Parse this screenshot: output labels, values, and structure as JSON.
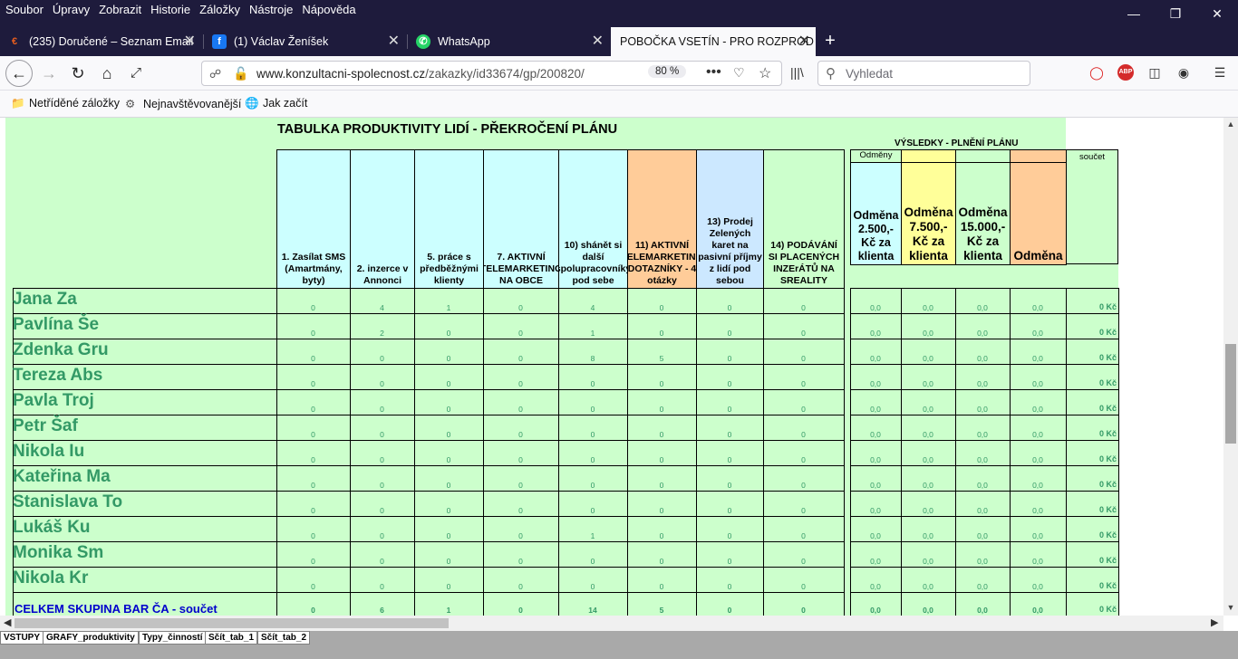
{
  "menu": [
    "Soubor",
    "Úpravy",
    "Zobrazit",
    "Historie",
    "Záložky",
    "Nástroje",
    "Nápověda"
  ],
  "tabs": [
    {
      "label": "(235) Doručené – Seznam Email",
      "icon": "seznam-icon",
      "color": "#e85d1e"
    },
    {
      "label": "(1) Václav Ženíšek",
      "icon": "facebook-icon",
      "color": "#1877f2"
    },
    {
      "label": "WhatsApp",
      "icon": "whatsapp-icon",
      "color": "#25d366"
    },
    {
      "label": "POBOČKA VSETÍN - PRO ROZPROD",
      "icon": "",
      "color": ""
    }
  ],
  "nav": {
    "url_domain": "www.konzultacni-spolecnost.cz",
    "url_path": "/zakazky/id33674/gp/200820/",
    "zoom": "80 %",
    "search_placeholder": "Vyhledat"
  },
  "bookmarks": [
    "Netříděné záložky",
    "Nejnavštěvovanější",
    "Jak začít"
  ],
  "sheet": {
    "title": "TABULKA PRODUKTIVITY LIDÍ - PŘEKROČENÍ PLÁNU",
    "results_title": "VÝSLEDKY - PLNĚNÍ PLÁNU",
    "odmeny_label": "Odměny",
    "soucet_label": "součet",
    "columns": [
      "1. Zasílat SMS (Amartmány, byty)",
      "2. inzerce v Annonci",
      "5. práce s předběžnými klienty",
      "7. AKTIVNÍ TELEMARKETING NA OBCE",
      "10) shánět si další spolupracovníky pod sebe",
      "11) AKTIVNÍ TELEMARKETING DOTAZNÍKY - 4 otázky",
      "13) Prodej Zelených karet na pasivní příjmy z lidí pod sebou",
      "14) PODÁVÁNÍ SI PLACENÝCH INZErÁTŮ NA SREALITY"
    ],
    "result_columns": [
      "Odměna 2.500,- Kč za klienta",
      "Odměna 7.500,- Kč za klienta",
      "Odměna 15.000,- Kč za klienta",
      "Odměna"
    ],
    "rows": [
      {
        "name": "Jana Za",
        "v": [
          "0",
          "4",
          "1",
          "0",
          "4",
          "0",
          "0",
          "0"
        ],
        "r": [
          "0,0",
          "0,0",
          "0,0",
          "0,0"
        ],
        "sum": "0 Kč"
      },
      {
        "name": "Pavlína Še",
        "v": [
          "0",
          "2",
          "0",
          "0",
          "1",
          "0",
          "0",
          "0"
        ],
        "r": [
          "0,0",
          "0,0",
          "0,0",
          "0,0"
        ],
        "sum": "0 Kč"
      },
      {
        "name": "Zdenka Gru",
        "v": [
          "0",
          "0",
          "0",
          "0",
          "8",
          "5",
          "0",
          "0"
        ],
        "r": [
          "0,0",
          "0,0",
          "0,0",
          "0,0"
        ],
        "sum": "0 Kč"
      },
      {
        "name": "Tereza Abs",
        "v": [
          "0",
          "0",
          "0",
          "0",
          "0",
          "0",
          "0",
          "0"
        ],
        "r": [
          "0,0",
          "0,0",
          "0,0",
          "0,0"
        ],
        "sum": "0 Kč"
      },
      {
        "name": "Pavla Troj",
        "v": [
          "0",
          "0",
          "0",
          "0",
          "0",
          "0",
          "0",
          "0"
        ],
        "r": [
          "0,0",
          "0,0",
          "0,0",
          "0,0"
        ],
        "sum": "0 Kč"
      },
      {
        "name": "Petr Šaf",
        "v": [
          "0",
          "0",
          "0",
          "0",
          "0",
          "0",
          "0",
          "0"
        ],
        "r": [
          "0,0",
          "0,0",
          "0,0",
          "0,0"
        ],
        "sum": "0 Kč"
      },
      {
        "name": "Nikola  Iu",
        "v": [
          "0",
          "0",
          "0",
          "0",
          "0",
          "0",
          "0",
          "0"
        ],
        "r": [
          "0,0",
          "0,0",
          "0,0",
          "0,0"
        ],
        "sum": "0 Kč"
      },
      {
        "name": "Kateřina Ma",
        "v": [
          "0",
          "0",
          "0",
          "0",
          "0",
          "0",
          "0",
          "0"
        ],
        "r": [
          "0,0",
          "0,0",
          "0,0",
          "0,0"
        ],
        "sum": "0 Kč"
      },
      {
        "name": "Stanislava To",
        "v": [
          "0",
          "0",
          "0",
          "0",
          "0",
          "0",
          "0",
          "0"
        ],
        "r": [
          "0,0",
          "0,0",
          "0,0",
          "0,0"
        ],
        "sum": "0 Kč"
      },
      {
        "name": "Lukáš Ku",
        "v": [
          "0",
          "0",
          "0",
          "0",
          "1",
          "0",
          "0",
          "0"
        ],
        "r": [
          "0,0",
          "0,0",
          "0,0",
          "0,0"
        ],
        "sum": "0 Kč"
      },
      {
        "name": "Monika Sm",
        "v": [
          "0",
          "0",
          "0",
          "0",
          "0",
          "0",
          "0",
          "0"
        ],
        "r": [
          "0,0",
          "0,0",
          "0,0",
          "0,0"
        ],
        "sum": "0 Kč"
      },
      {
        "name": "Nikola Kr",
        "v": [
          "0",
          "0",
          "0",
          "0",
          "0",
          "0",
          "0",
          "0"
        ],
        "r": [
          "0,0",
          "0,0",
          "0,0",
          "0,0"
        ],
        "sum": "0 Kč"
      }
    ],
    "total": {
      "label": "CELKEM SKUPINA BAR ČA  - součet",
      "v": [
        "0",
        "6",
        "1",
        "0",
        "14",
        "5",
        "0",
        "0"
      ],
      "r": [
        "0,0",
        "0,0",
        "0,0",
        "0,0"
      ],
      "sum": "0 Kč"
    },
    "colors": {
      "sheet_bg": "#ccffcc",
      "header_cyan": "#ccffff",
      "header_orange": "#ffcc99",
      "header_lightblue": "#cce8ff",
      "header_yellow": "#ffff99",
      "value_green": "#339966",
      "total_blue": "#0000cc"
    }
  },
  "sheet_tabs": [
    "VSTUPY",
    "GRAFY_produktivity",
    "Typy_činností",
    "Sčít_tab_1",
    "Sčít_tab_2"
  ]
}
